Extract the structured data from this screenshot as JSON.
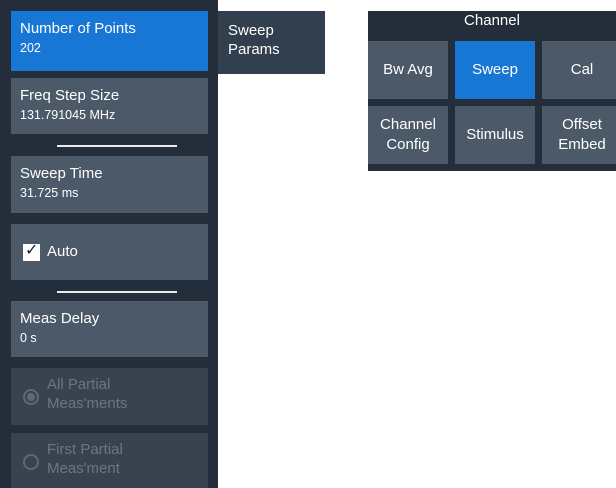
{
  "softkeys": {
    "number_of_points": {
      "label": "Number of Points",
      "value": "202"
    },
    "freq_step_size": {
      "label": "Freq Step Size",
      "value": "131.791045 MHz"
    },
    "sweep_time": {
      "label": "Sweep Time",
      "value": "31.725 ms"
    },
    "auto": {
      "label": "Auto",
      "checked": true
    },
    "meas_delay": {
      "label": "Meas Delay",
      "value": "0 s"
    },
    "all_partial": {
      "label_line1": "All Partial",
      "label_line2": "Meas'ments",
      "selected": true,
      "enabled": false
    },
    "first_partial": {
      "label_line1": "First Partial",
      "label_line2": "Meas'ment",
      "selected": false,
      "enabled": false
    }
  },
  "tab": {
    "line1": "Sweep",
    "line2": "Params"
  },
  "channel_menu": {
    "title": "Channel",
    "buttons": [
      {
        "label": "Bw Avg",
        "active": false
      },
      {
        "label": "Sweep",
        "active": true
      },
      {
        "label": "Cal",
        "active": false
      },
      {
        "label": "Channel\nConfig",
        "active": false
      },
      {
        "label": "Stimulus",
        "active": false
      },
      {
        "label": "Offset\nEmbed",
        "active": false
      }
    ]
  },
  "colors": {
    "panel_bg": "#232e3a",
    "key_bg": "#4b5968",
    "active_blue": "#1877d4",
    "disabled_text": "#6a7684"
  },
  "icons": {
    "check": "check-icon",
    "radio_selected": "radio-selected-icon",
    "radio_unselected": "radio-unselected-icon"
  }
}
